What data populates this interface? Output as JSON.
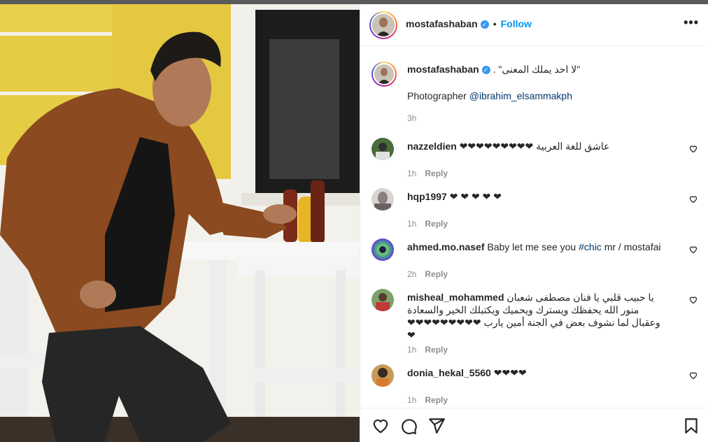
{
  "post": {
    "username": "mostafashaban",
    "follow_label": "Follow",
    "more_label": "•••",
    "dot": "•",
    "caption_arabic": "\"لا احد يملك المعنى\" .",
    "caption_line2_prefix": "Photographer ",
    "caption_mention": "@ibrahim_elsammakph",
    "caption_time": "3h"
  },
  "comments": [
    {
      "username": "nazzeldien",
      "text": "عاشق للغة العربية ❤❤❤❤❤❤❤❤❤",
      "time": "1h",
      "reply": "Reply",
      "avatar_color": "#4a6b3a"
    },
    {
      "username": "hqp1997",
      "text": "❤ ❤ ❤ ❤ ❤",
      "time": "1h",
      "reply": "Reply",
      "avatar_color": "#8a7f80"
    },
    {
      "username": "ahmed.mo.nasef",
      "text_pre": "Baby let me see you ",
      "hashtag": "#chic",
      "text_post": " mr / mostafai",
      "time": "2h",
      "reply": "Reply",
      "avatar_color": "#5a7fd0"
    },
    {
      "username": "misheal_mohammed",
      "text": "يا حبيب قلبي يا فنان مصطفى شعبان منور الله يحفظك ويسترك ويحميك ويكتبلك الخير والسعادة وعقبال لما نشوف بعض في الجنة أمين يارب ❤❤❤❤❤❤❤❤❤❤",
      "time": "1h",
      "reply": "Reply",
      "avatar_color": "#b05050"
    },
    {
      "username": "donia_hekal_5560",
      "text": "❤❤❤❤",
      "time": "1h",
      "reply": "Reply",
      "avatar_color": "#a66a30"
    }
  ],
  "icons": {
    "like": "heart-icon",
    "comment": "comment-icon",
    "share": "share-icon",
    "save": "bookmark-icon",
    "options": "more-options-icon",
    "verified": "verified-badge-icon"
  },
  "colors": {
    "follow_blue": "#0095f6",
    "mention_link": "#00376b",
    "verified_blue": "#3897f0",
    "meta_gray": "#8e8e8e"
  }
}
